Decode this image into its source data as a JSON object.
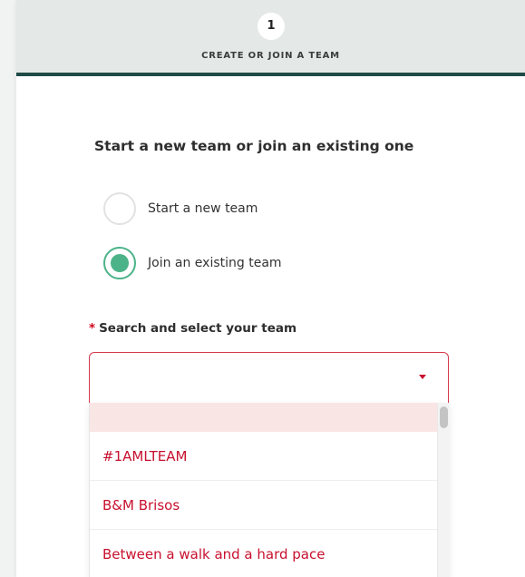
{
  "stepper": {
    "step_number": "1",
    "step_label": "CREATE OR JOIN A TEAM"
  },
  "team_choice": {
    "title": "Start a new team or join an existing one",
    "options": [
      {
        "label": "Start a new team",
        "selected": false
      },
      {
        "label": "Join an existing team",
        "selected": true
      }
    ]
  },
  "team_search": {
    "required_marker": "*",
    "label": "Search and select your team",
    "value": "",
    "options": [
      "#1AMLTEAM",
      "B&M Brisos",
      "Between a walk and a hard pace"
    ]
  },
  "colors": {
    "accent_green": "#4cb389",
    "option_red": "#c8102e",
    "stepper_bar": "#1f4a45"
  }
}
